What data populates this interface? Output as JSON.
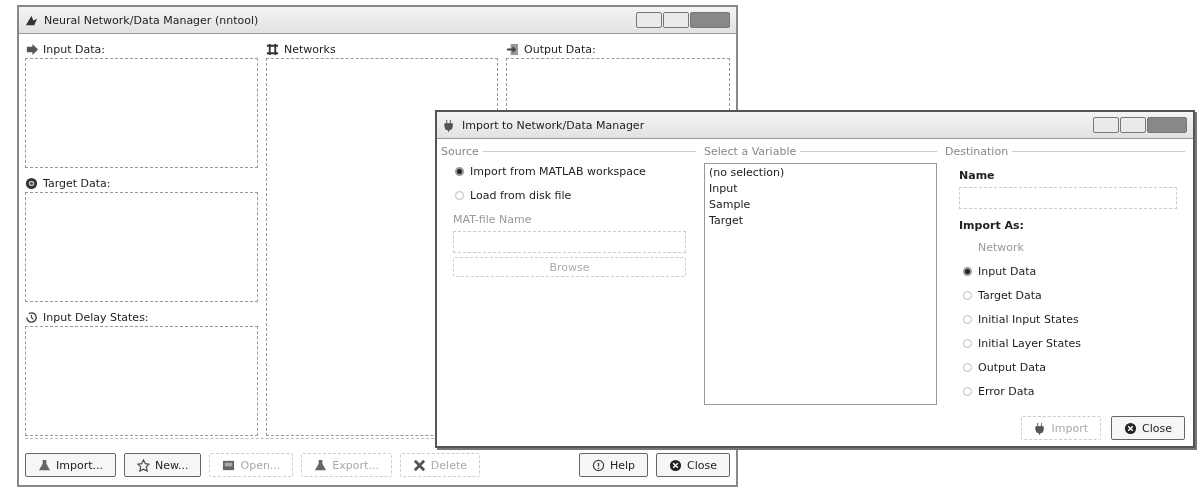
{
  "main_window": {
    "title": "Neural Network/Data Manager (nntool)",
    "left_panels": [
      {
        "label": "Input Data:"
      },
      {
        "label": "Target Data:"
      },
      {
        "label": "Input Delay States:"
      }
    ],
    "networks_panel": {
      "label": "Networks"
    },
    "output_panel": {
      "label": "Output Data:"
    },
    "buttons": [
      {
        "label": "Import...",
        "disabled": false
      },
      {
        "label": "New...",
        "disabled": false
      },
      {
        "label": "Open...",
        "disabled": true
      },
      {
        "label": "Export...",
        "disabled": true
      },
      {
        "label": "Delete",
        "disabled": true
      }
    ],
    "right_buttons": [
      {
        "label": "Help",
        "disabled": false
      },
      {
        "label": "Close",
        "disabled": false
      }
    ]
  },
  "import_dialog": {
    "title": "Import to Network/Data Manager",
    "source": {
      "legend": "Source",
      "options": [
        {
          "label": "Import from MATLAB workspace",
          "selected": true
        },
        {
          "label": "Load from disk file",
          "selected": false
        }
      ],
      "file_label": "MAT-file Name",
      "browse_button": {
        "label": "Browse",
        "disabled": true
      }
    },
    "variables": {
      "legend": "Select a Variable",
      "items": [
        "(no selection)",
        "Input",
        "Sample",
        "Target"
      ]
    },
    "destination": {
      "legend": "Destination",
      "name_label": "Name",
      "import_as_label": "Import As:",
      "options": [
        {
          "label": "Network",
          "disabled": true
        },
        {
          "label": "Input Data",
          "selected": true,
          "disabled": false
        },
        {
          "label": "Target Data",
          "selected": false,
          "disabled": false
        },
        {
          "label": "Initial Input States",
          "selected": false,
          "disabled": false
        },
        {
          "label": "Initial Layer States",
          "selected": false,
          "disabled": false
        },
        {
          "label": "Output Data",
          "selected": false,
          "disabled": false
        },
        {
          "label": "Error Data",
          "selected": false,
          "disabled": false
        }
      ]
    },
    "buttons": [
      {
        "label": "Import",
        "disabled": true
      },
      {
        "label": "Close",
        "disabled": false
      }
    ]
  }
}
